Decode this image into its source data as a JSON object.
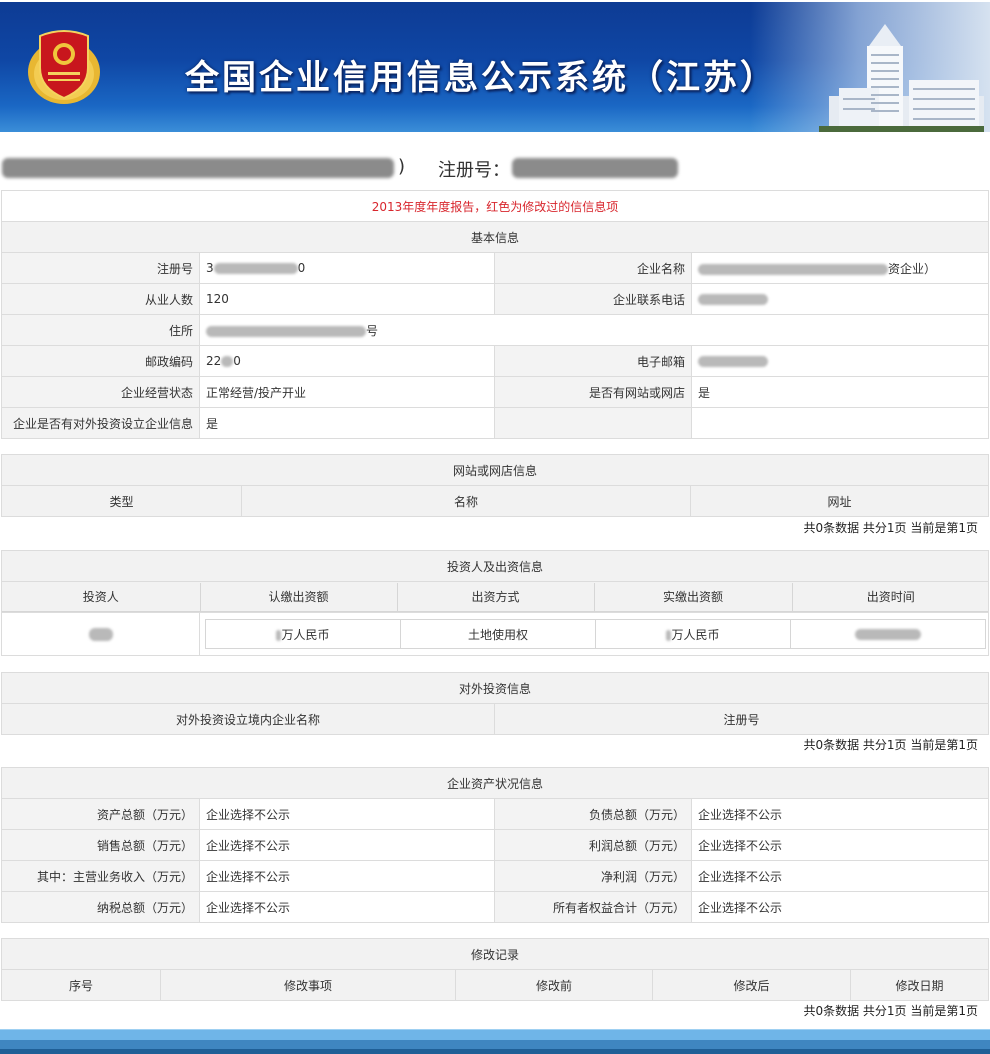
{
  "banner": {
    "title": "全国企业信用信息公示系统（江苏）",
    "emblem_icon": "industry-commerce-emblem",
    "building_image": "government-building-photo"
  },
  "company": {
    "name_redacted": "（已模糊处理）",
    "name_suffix": ")",
    "reg_label": "注册号："
  },
  "notice": "2013年度年度报告，红色为修改过的信信息项",
  "basic_info": {
    "title": "基本信息",
    "rows": [
      {
        "l1": "注册号",
        "v1": "3",
        "v1_redacted": true,
        "v1_suffix": "0",
        "l2": "企业名称",
        "v2": "资企业）",
        "v2_redacted": true
      },
      {
        "l1": "从业人数",
        "v1": "120",
        "l2": "企业联系电话",
        "v2": "",
        "v2_redacted": true
      },
      {
        "l1": "住所",
        "v1": "号",
        "v1_redacted": true
      },
      {
        "l1": "邮政编码",
        "v1": "22",
        "v1_redacted": true,
        "v1_suffix": "0",
        "l2": "电子邮箱",
        "v2": "",
        "v2_redacted": true
      },
      {
        "l1": "企业经营状态",
        "v1": "正常经营/投产开业",
        "l2": "是否有网站或网店",
        "v2": "是"
      },
      {
        "l1": "企业是否有对外投资设立企业信息",
        "v1": "是",
        "l2": "",
        "v2": ""
      }
    ]
  },
  "website_info": {
    "title": "网站或网店信息",
    "columns": [
      "类型",
      "名称",
      "网址"
    ],
    "pager": "共0条数据 共分1页 当前是第1页"
  },
  "investor_info": {
    "title": "投资人及出资信息",
    "columns": [
      "投资人",
      "认缴出资额",
      "出资方式",
      "实缴出资额",
      "出资时间"
    ],
    "rows": [
      {
        "investor": "",
        "subscribed": "万人民币",
        "method": "土地使用权",
        "paid": "万人民币",
        "date": ""
      }
    ]
  },
  "outbound_investment": {
    "title": "对外投资信息",
    "columns": [
      "对外投资设立境内企业名称",
      "注册号"
    ],
    "pager": "共0条数据 共分1页 当前是第1页"
  },
  "assets_info": {
    "title": "企业资产状况信息",
    "rows": [
      {
        "l1": "资产总额（万元）",
        "v1": "企业选择不公示",
        "l2": "负债总额（万元）",
        "v2": "企业选择不公示"
      },
      {
        "l1": "销售总额（万元）",
        "v1": "企业选择不公示",
        "l2": "利润总额（万元）",
        "v2": "企业选择不公示"
      },
      {
        "l1": "其中：主营业务收入（万元）",
        "v1": "企业选择不公示",
        "l2": "净利润（万元）",
        "v2": "企业选择不公示"
      },
      {
        "l1": "纳税总额（万元）",
        "v1": "企业选择不公示",
        "l2": "所有者权益合计（万元）",
        "v2": "企业选择不公示"
      }
    ]
  },
  "modification_records": {
    "title": "修改记录",
    "columns": [
      "序号",
      "修改事项",
      "修改前",
      "修改后",
      "修改日期"
    ],
    "pager": "共0条数据 共分1页 当前是第1页"
  },
  "colors": {
    "banner_blue": "#0f47a5",
    "notice_red": "#d8262d",
    "header_gray": "#f2f2f2",
    "footer_blue": "#3f86c0"
  }
}
